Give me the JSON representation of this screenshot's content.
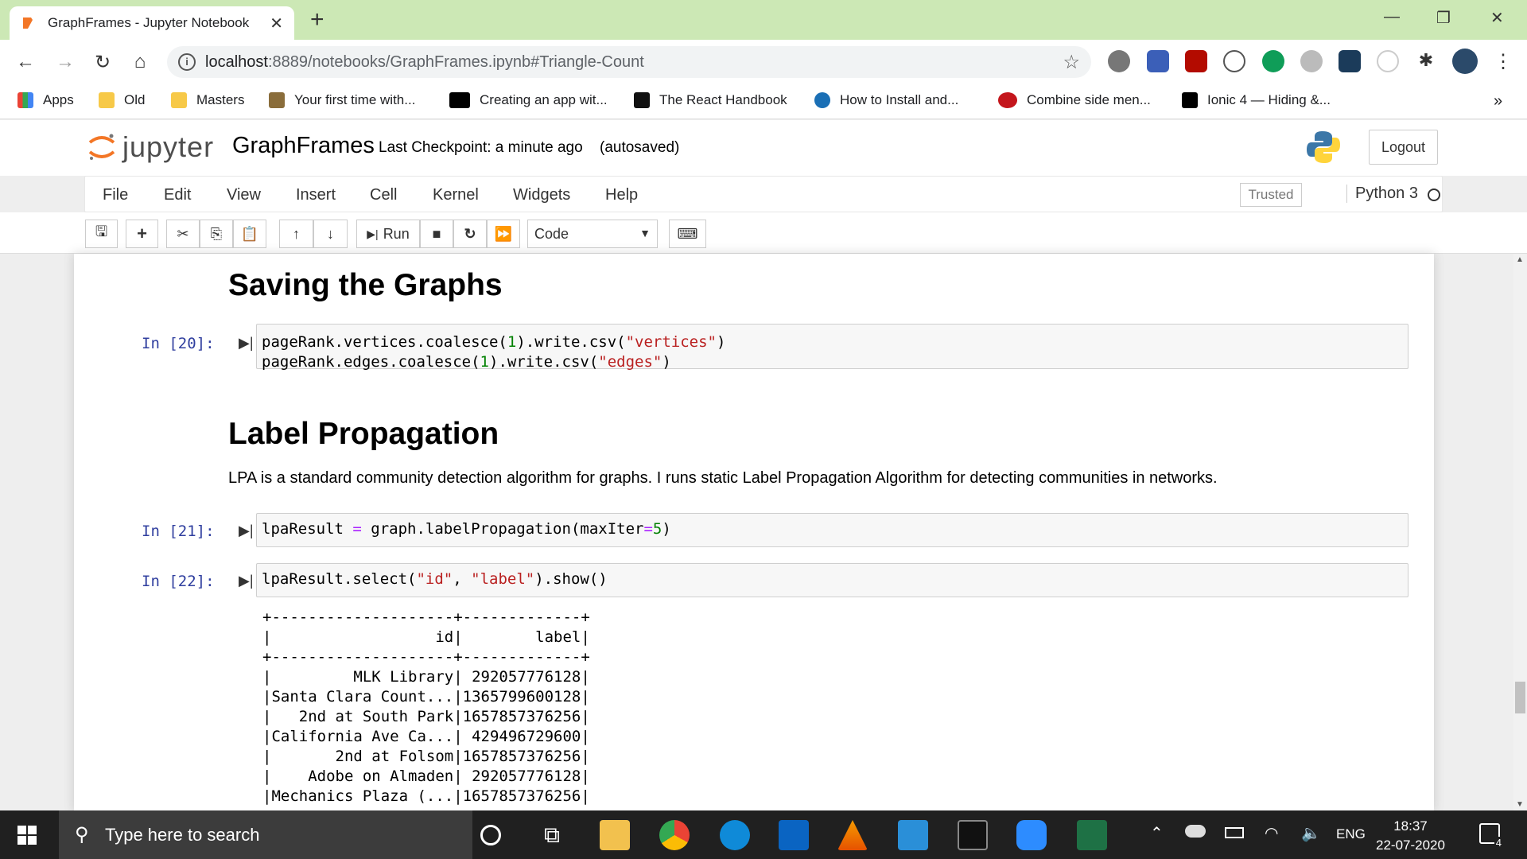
{
  "browser": {
    "tab_title": "GraphFrames - Jupyter Notebook",
    "url_host": "localhost",
    "url_path": ":8889/notebooks/GraphFrames.ipynb#Triangle-Count",
    "bookmarks": [
      "Apps",
      "Old",
      "Masters",
      "Your first time with...",
      "Creating an app wit...",
      "The React Handbook",
      "How to Install and...",
      "Combine side men...",
      "Ionic 4 — Hiding &..."
    ],
    "more_bookmarks": "»"
  },
  "jupyter": {
    "logo_text": "jupyter",
    "notebook_name": "GraphFrames",
    "checkpoint": "Last Checkpoint: a minute ago",
    "autosaved": "(autosaved)",
    "logout": "Logout",
    "menu": [
      "File",
      "Edit",
      "View",
      "Insert",
      "Cell",
      "Kernel",
      "Widgets",
      "Help"
    ],
    "trusted": "Trusted",
    "kernel": "Python 3",
    "toolbar": {
      "run_label": "Run",
      "cell_type": "Code"
    }
  },
  "notebook": {
    "heading1": "Saving the Graphs",
    "cell20": {
      "prompt": "In [20]:"
    },
    "heading2": "Label Propagation",
    "lpa_text": "LPA is a standard community detection algorithm for graphs. I runs static Label Propagation Algorithm for detecting communities in networks.",
    "cell21": {
      "prompt": "In [21]:"
    },
    "cell22": {
      "prompt": "In [22]:"
    },
    "output22": "+--------------------+-------------+\n|                  id|        label|\n+--------------------+-------------+\n|         MLK Library| 292057776128|\n|Santa Clara Count...|1365799600128|\n|   2nd at South Park|1657857376256|\n|California Ave Ca...| 429496729600|\n|       2nd at Folsom|1657857376256|\n|    Adobe on Almaden| 292057776128|\n|Mechanics Plaza (...|1657857376256|"
  },
  "taskbar": {
    "search_placeholder": "Type here to search",
    "lang": "ENG",
    "time": "18:37",
    "date": "22-07-2020",
    "notification_count": "4"
  }
}
